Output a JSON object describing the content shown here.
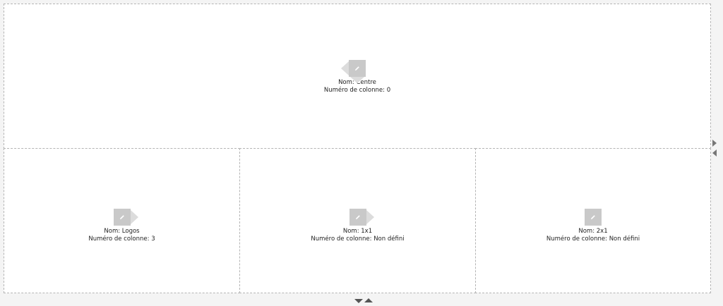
{
  "blocks": [
    {
      "id": "centre",
      "name_line": "Nom: Centre",
      "column_line": "Numéro de colonne: 0",
      "icons": [
        "pencil-icon",
        "arrow-left-icon",
        "arrow-down-icon"
      ]
    },
    {
      "id": "logos",
      "name_line": "Nom: Logos",
      "column_line": "Numéro de colonne: 3",
      "icons": [
        "pencil-icon",
        "arrow-right-icon"
      ]
    },
    {
      "id": "1x1",
      "name_line": "Nom: 1x1",
      "column_line": "Numéro de colonne: Non défini",
      "icons": [
        "pencil-icon",
        "arrow-right-icon"
      ]
    },
    {
      "id": "2x1",
      "name_line": "Nom: 2x1",
      "column_line": "Numéro de colonne: Non défini",
      "icons": [
        "pencil-icon"
      ]
    }
  ],
  "controls": {
    "side": [
      "expand-right-icon",
      "shrink-left-icon"
    ],
    "bottom": [
      "expand-down-icon",
      "shrink-up-icon"
    ]
  },
  "colors": {
    "background": "#f4f4f4",
    "block_background": "#ffffff",
    "border": "#b4b4b4",
    "button": "#c9c9c9",
    "arrow": "#dcdcdc",
    "text": "#222222"
  }
}
